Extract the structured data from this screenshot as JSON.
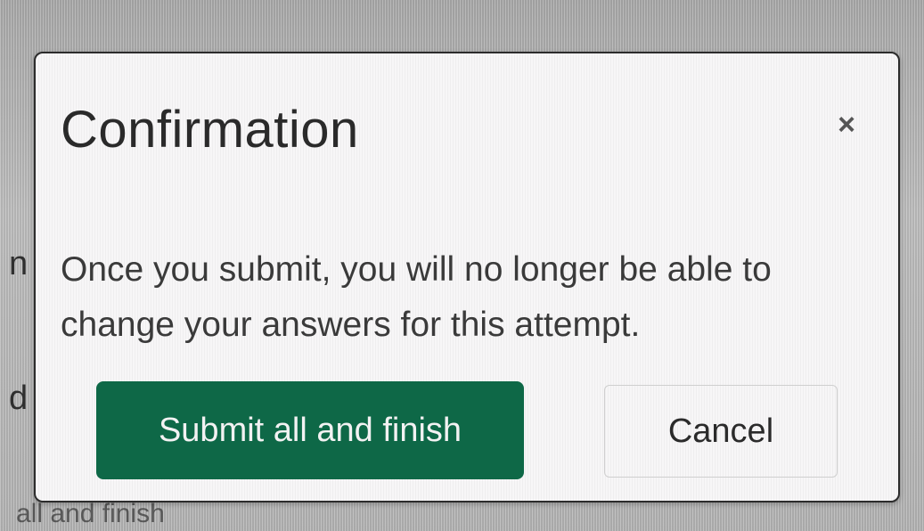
{
  "background": {
    "fragments": [
      "n",
      "d",
      "all and finish"
    ]
  },
  "modal": {
    "title": "Confirmation",
    "close_label": "×",
    "message": "Once you submit, you will no longer be able to change your answers for this attempt.",
    "buttons": {
      "submit_label": "Submit all and finish",
      "cancel_label": "Cancel"
    }
  },
  "colors": {
    "primary_button": "#0e6847",
    "modal_background": "#f7f6f7"
  },
  "icons": {
    "close": "close-icon"
  }
}
